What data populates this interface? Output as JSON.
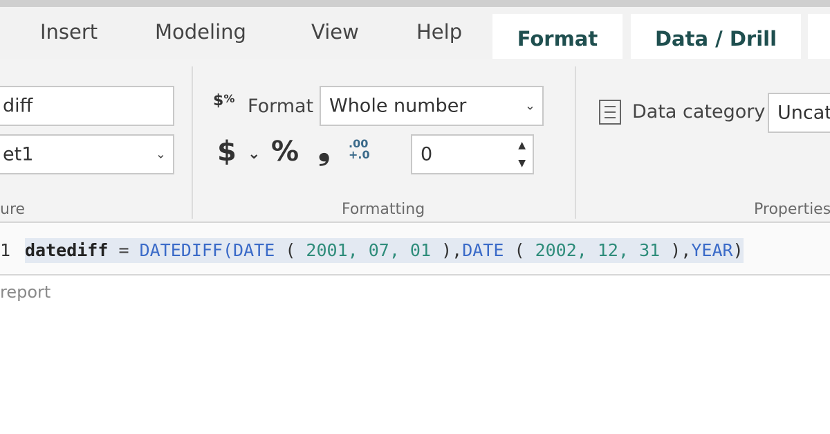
{
  "tabs": [
    {
      "label": "Insert"
    },
    {
      "label": "Modeling"
    },
    {
      "label": "View"
    },
    {
      "label": "Help"
    },
    {
      "label": "Format",
      "active": true
    },
    {
      "label": "Data / Drill",
      "active": true
    }
  ],
  "structure": {
    "name_value": "diff",
    "table_value": "et1",
    "group_label": "ure"
  },
  "formatting": {
    "format_label": "Format",
    "format_value": "Whole number",
    "currency_symbol": "$",
    "percent_symbol": "%",
    "comma_symbol": "❟",
    "decimals_value": "0",
    "group_label": "Formatting"
  },
  "properties": {
    "data_category_label": "Data category",
    "data_category_value": "Uncat",
    "group_label": "Properties"
  },
  "formula": {
    "line_number": "1",
    "tokens": {
      "name": "datediff",
      "eq": " = ",
      "fn1": "DATEDIFF(",
      "fn2": "DATE",
      "p1": " ( ",
      "n1": "2001, 07, 01",
      "p2": " ),",
      "fn3": "DATE",
      "p3": " ( ",
      "n2": "2002, 12, 31",
      "p4": " ),",
      "fn4": "YEAR",
      "p5": ")"
    }
  },
  "canvas": {
    "label": "report"
  }
}
